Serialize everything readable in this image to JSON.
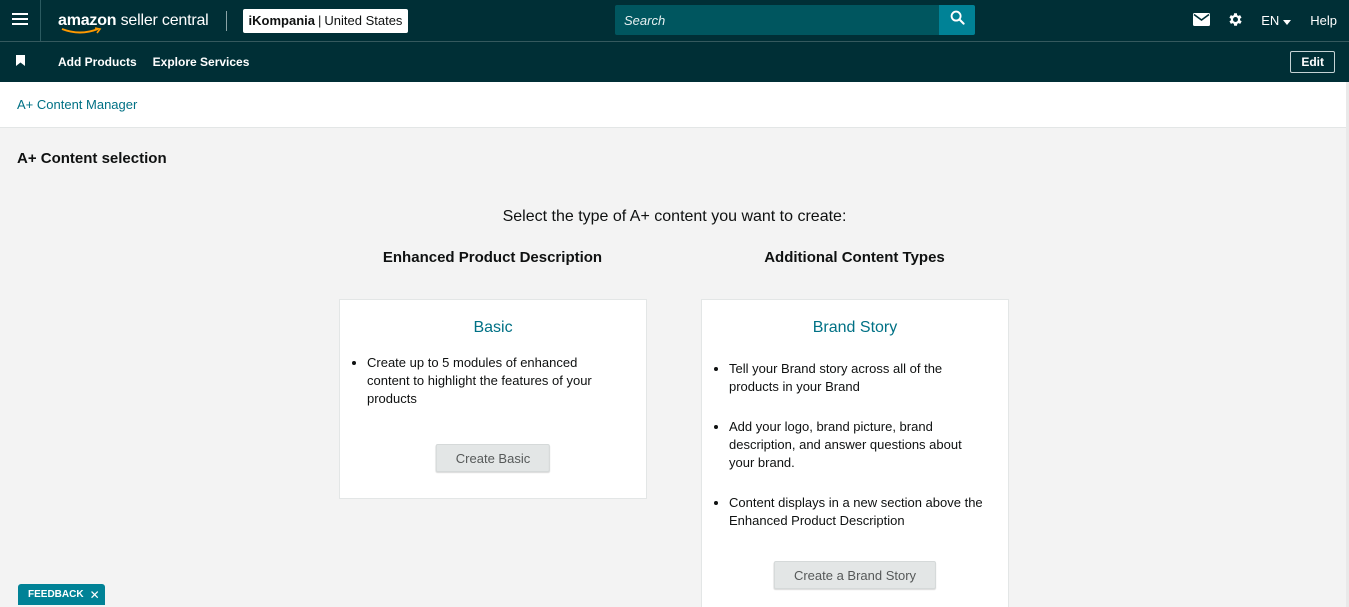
{
  "header": {
    "logo_bold": "amazon",
    "logo_rest": " seller central",
    "account_name": "iKompania",
    "account_sep": "|",
    "account_region": "United States",
    "search_placeholder": "Search",
    "language": "EN",
    "help": "Help"
  },
  "nav": {
    "items": [
      {
        "label": "Add Products"
      },
      {
        "label": "Explore Services"
      }
    ],
    "edit_label": "Edit"
  },
  "breadcrumb": {
    "label": "A+ Content Manager"
  },
  "page": {
    "title": "A+ Content selection",
    "prompt": "Select the type of A+ content you want to create:",
    "left_heading": "Enhanced Product Description",
    "right_heading": "Additional Content Types"
  },
  "cards": {
    "basic": {
      "title": "Basic",
      "bullets": [
        "Create up to 5 modules of enhanced content to highlight the features of your products"
      ],
      "button": "Create Basic"
    },
    "brand": {
      "title": "Brand Story",
      "bullets": [
        "Tell your Brand story across all of the products in your Brand",
        "Add your logo, brand picture, brand description, and answer questions about your brand.",
        "Content displays in a new section above the Enhanced Product Description"
      ],
      "button": "Create a Brand Story"
    }
  },
  "feedback": {
    "label": "FEEDBACK",
    "close": "✕"
  },
  "colors": {
    "header_bg": "#002f36",
    "search_bg": "#00565f",
    "search_button": "#008296",
    "link": "#007185",
    "feedback_bg": "#008296"
  },
  "icons": {
    "menu": "hamburger-icon",
    "mail": "mail-icon",
    "settings": "gear-icon",
    "search": "search-icon",
    "bookmark": "bookmark-icon",
    "caret": "caret-down-icon"
  }
}
